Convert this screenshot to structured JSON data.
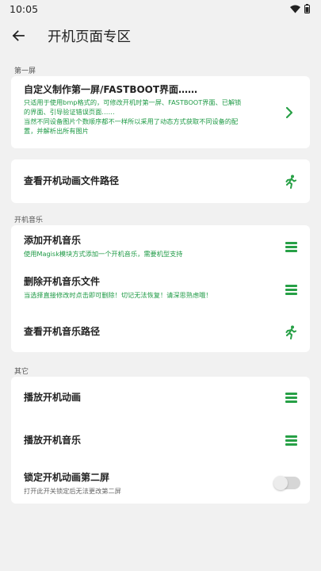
{
  "status_bar": {
    "time": "10:05"
  },
  "app_bar": {
    "title": "开机页面专区"
  },
  "sections": {
    "first_screen": "第一屏",
    "boot_music": "开机音乐",
    "other": "其它"
  },
  "card1": {
    "title": "自定义制作第一屏/FASTBOOT界面……",
    "sub_lines": [
      "只适用于使用bmp格式的，可修改开机时第一屏、FASTBOOT界面、已解锁",
      "的界面、引导验证错误页面……",
      "当然不同设备图片个数顺序都不一样所以采用了动态方式获取不同设备的配",
      "置，并解析出所有图片"
    ]
  },
  "card2": {
    "title": "查看开机动画文件路径"
  },
  "card3": {
    "add_music": {
      "title": "添加开机音乐",
      "sub": "使用Magisk模块方式添加一个开机音乐，需要机型支持"
    },
    "delete_music": {
      "title": "删除开机音乐文件",
      "sub": "当选择直接修改时点击即可删除！切记无法恢复！请深思熟虑哦！"
    },
    "view_music_path": {
      "title": "查看开机音乐路径"
    }
  },
  "card4": {
    "play_animation": {
      "title": "播放开机动画"
    },
    "play_music": {
      "title": "播放开机音乐"
    },
    "lock_second_screen": {
      "title": "锁定开机动画第二屏",
      "sub": "打开此开关锁定后无法更改第二屏",
      "enabled": false
    }
  },
  "colors": {
    "accent": "#27a046",
    "background": "#f1f1f1",
    "card": "#ffffff"
  }
}
